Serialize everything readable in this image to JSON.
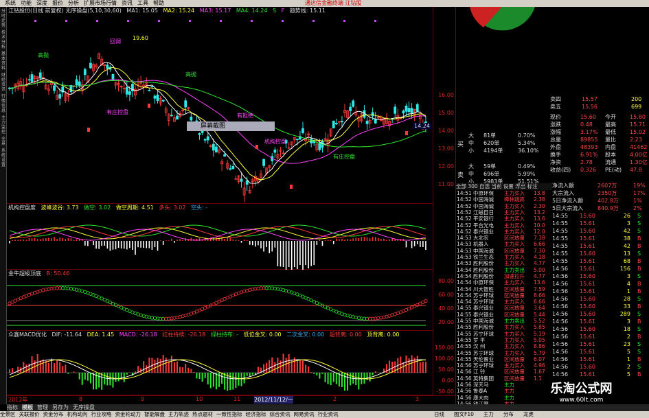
{
  "menu": [
    "系统",
    "功能",
    "深度",
    "报价",
    "分析",
    "扩展市场行情",
    "资讯",
    "工具",
    "帮助"
  ],
  "menu_right": "通达信金融终端  江钻股",
  "left_tabs": [
    "分时走势",
    "技术分析",
    "基本资料",
    "财经资讯",
    "行情信息",
    "主力监控",
    "全景",
    "系统设置"
  ],
  "main": {
    "title": "江钻股份(日线 前复权) 无序操盘(5,10,30,60)",
    "ma1": "MA1: 15.05",
    "ma2": "MA2: 15.24",
    "ma3": "MA3: 15.17",
    "ma4": "MA4: 14.24",
    "s": "S",
    "f": "F",
    "trend": "趋势线: 15.11",
    "high": "19.60",
    "low": "10.31",
    "screenshot": "屏幕截图",
    "labels": [
      "高抛",
      "回调",
      "有庄控盘",
      "高抛",
      "有拒绝",
      "机构控盘",
      "有庄控盘"
    ],
    "price_tag": "14.24",
    "yticks": [
      "19.00",
      "18.00",
      "17.00",
      "16.00",
      "15.00",
      "14.00",
      "13.00",
      "12.00",
      "11.00"
    ]
  },
  "p2": {
    "title": "机构控盘度",
    "items": [
      "波峰波谷: 3.73",
      "做空: 3.02",
      "做空周期: 4.51",
      "多头: 3.02",
      "空头: -"
    ]
  },
  "p3": {
    "title": "金牛超级顶底",
    "items": [
      "B: 50.46"
    ],
    "yticks": [
      "80.00",
      "60.00",
      "40.00",
      "20.00"
    ]
  },
  "p4": {
    "title": "众鑫MACD优化",
    "items": [
      "DIF: -11.64",
      "DEA: 1.45",
      "MACD: -26.18",
      "红柱持续: -26.18",
      "绿柱持布: -",
      "低位金叉: 0.00",
      "二次金叉: 0.00",
      "超背离: 0.00",
      "顶背离: 0.00"
    ],
    "yticks": [
      "150.00",
      "100.00",
      "50.00",
      "0.00",
      "-50.00"
    ]
  },
  "xaxis": [
    "2012年",
    "8",
    "9",
    "10",
    "11",
    "2012/11/12/一",
    "2",
    "3"
  ],
  "order": {
    "sell": [
      [
        "卖四",
        "15.57",
        "200"
      ],
      [
        "卖五",
        "15.56",
        "699"
      ]
    ],
    "quote": [
      [
        "现价",
        "15.60",
        "今开",
        "15.80"
      ],
      [
        "涨跌",
        "0.48",
        "最高",
        "15.71"
      ],
      [
        "涨幅",
        "3.17%",
        "最低",
        "15.02"
      ],
      [
        "总量",
        "89855",
        "量比",
        "2.23"
      ],
      [
        "外盘",
        "48393",
        "内盘",
        "41462"
      ],
      [
        "换手",
        "6.91%",
        "股本",
        "4.00亿"
      ],
      [
        "净资",
        "2.78",
        "流通",
        "1.30亿"
      ],
      [
        "收益(四)",
        "0.326",
        "PE(动)",
        "47.8"
      ]
    ]
  },
  "flow": [
    [
      "大",
      "81单",
      "0.70%"
    ],
    [
      "中",
      "620单",
      "5.34%"
    ],
    [
      "小",
      "4194单",
      "36.10%"
    ],
    [
      "大",
      "59单",
      "0.49%"
    ],
    [
      "中",
      "696单",
      "5.99%"
    ],
    [
      "小",
      "5983单",
      "51.51%"
    ]
  ],
  "flow_side": [
    "买",
    "卖"
  ],
  "ticker_tabs": "全部 300 自选 当前 设置 浮出 标注",
  "capital": [
    [
      "净流入额",
      "2607万",
      "19%"
    ],
    [
      "大宗流入",
      "2350万",
      "17%"
    ],
    [
      "5日净流入额",
      "402.8万",
      "1%"
    ],
    [
      "5日大宗流入",
      "840.9万",
      "2%"
    ]
  ],
  "ticker": [
    [
      "14:51",
      "中原环保",
      "主力买入",
      "13.8"
    ],
    [
      "14:52",
      "中国海诚",
      "樟林跳高",
      "2.38"
    ],
    [
      "14:52",
      "中国海诚",
      "主力买入",
      "2.30"
    ],
    [
      "14:52",
      "江磁目日",
      "主力买入",
      "13.2"
    ],
    [
      "14:52",
      "平安银行",
      "主力买入",
      "13.6"
    ],
    [
      "14:52",
      "平台光电",
      "主力买入",
      "10.0"
    ],
    [
      "14:52",
      "泰兴镇业",
      "主力买入",
      "12.0"
    ],
    [
      "14:53",
      "大北农",
      "区间放量",
      "7.18"
    ],
    [
      "14:53",
      "机器人",
      "主力买入",
      "6.66"
    ],
    [
      "14:53",
      "中国海诚",
      "区间放量",
      "7.30"
    ],
    [
      "14:53",
      "铁兰生态",
      "主力买入",
      "4.18"
    ],
    [
      "14:53",
      "胜利股份",
      "主力买入",
      "4.77"
    ],
    [
      "14:54",
      "胜利股份",
      "主力卖出",
      "5.00"
    ],
    [
      "14:54",
      "胜利股份",
      "加速拉升",
      "4.77"
    ],
    [
      "14:54",
      "中原环保",
      "主力买入",
      "13.6"
    ],
    [
      "14:54",
      "川大智胜",
      "区间放量",
      "7.59"
    ],
    [
      "14:54",
      "苏宁环球",
      "区间放量",
      "8.66"
    ],
    [
      "14:54",
      "苏宁环球",
      "主力买入",
      "6.66"
    ],
    [
      "14:55",
      "泰兴镇业",
      "区间放量",
      "3.64"
    ],
    [
      "14:55",
      "泰兴镇业",
      "区间放量",
      "5.44"
    ],
    [
      "14:55",
      "中国海诚",
      "主力卖出",
      "5.52"
    ],
    [
      "14:55",
      "胜利股份",
      "主力买入",
      "5.85"
    ],
    [
      "14:55",
      "苏宁环球",
      "主力买入",
      "5.19"
    ],
    [
      "14:55",
      "罗 平",
      "主力买入",
      "5.05"
    ],
    [
      "14:55",
      "汉 州",
      "主力买入",
      "8.86"
    ],
    [
      "14:55",
      "苏宁环球",
      "主力买入",
      "5.79"
    ],
    [
      "14:55",
      "天伦置业",
      "区间放量",
      "6.07"
    ],
    [
      "14:56",
      "苏宁环球",
      "主力买入",
      "4.96"
    ],
    [
      "14:56",
      "江 铃",
      "区间放量",
      "1.67"
    ],
    [
      "14:56",
      "英特集团",
      "区间放量",
      "1.1"
    ],
    [
      "14:56",
      "深天马",
      "主力卖出",
      "1.1"
    ],
    [
      "14:56",
      "鲁泰A",
      "主力买入",
      "1.1"
    ],
    [
      "14:56",
      "康大肉",
      "主力卖出",
      "1.1"
    ],
    [
      "14:56",
      "钱江摩",
      "主力买入",
      "1.1"
    ]
  ],
  "trades": [
    [
      "14:55",
      "15.60",
      "26",
      "S"
    ],
    [
      "14:55",
      "15.61",
      "3",
      "S"
    ],
    [
      "14:55",
      "15.60",
      "42",
      "S"
    ],
    [
      "14:55",
      "15.61",
      "38",
      "B"
    ],
    [
      "14:55",
      "15.61",
      "42",
      "B"
    ],
    [
      "14:55",
      "15.60",
      "13",
      "S"
    ],
    [
      "14:55",
      "15.61",
      "68",
      "B"
    ],
    [
      "14:56",
      "15.61",
      "156",
      "B"
    ],
    [
      "14:56",
      "15.60",
      "3",
      "S"
    ],
    [
      "14:56",
      "15.61",
      "4",
      "B"
    ],
    [
      "14:56",
      "15.61",
      "1",
      "B"
    ],
    [
      "14:56",
      "15.60",
      "28",
      "S"
    ],
    [
      "14:56",
      "15.60",
      "33",
      "B"
    ],
    [
      "14:56",
      "15.60",
      "289",
      "S"
    ],
    [
      "14:56",
      "15.61",
      "3",
      "B"
    ],
    [
      "14:56",
      "15.60",
      "18",
      "S"
    ],
    [
      "14:56",
      "15.61",
      "2",
      "B"
    ],
    [
      "14:56",
      "15.61",
      "23",
      "S"
    ],
    [
      "14:56",
      "15.61",
      "5",
      "S"
    ],
    [
      "14:56",
      "15.61",
      "1",
      "B"
    ],
    [
      "14:56",
      "15.60",
      "2",
      "S"
    ],
    [
      "14:56",
      "15.61",
      "5",
      "B"
    ]
  ],
  "bottom_tabs": [
    "指标",
    "模板",
    "管理",
    "另存为",
    "无序操盘"
  ],
  "statusbar": [
    "全景区",
    "关联报价",
    "资金分布",
    "机构动向",
    "行业攻略",
    "资金轮动力",
    "智能解盘",
    "主力轨迹",
    "热点题材",
    "一致性指标",
    "经济指标",
    "综合资讯",
    "网易资讯",
    "行业资讯"
  ],
  "status_right": [
    "日线",
    "图文F10",
    "主力",
    "分布",
    "龙虎"
  ],
  "watermark": {
    "title": "乐淘公式网",
    "url": "www.60lt.com"
  }
}
